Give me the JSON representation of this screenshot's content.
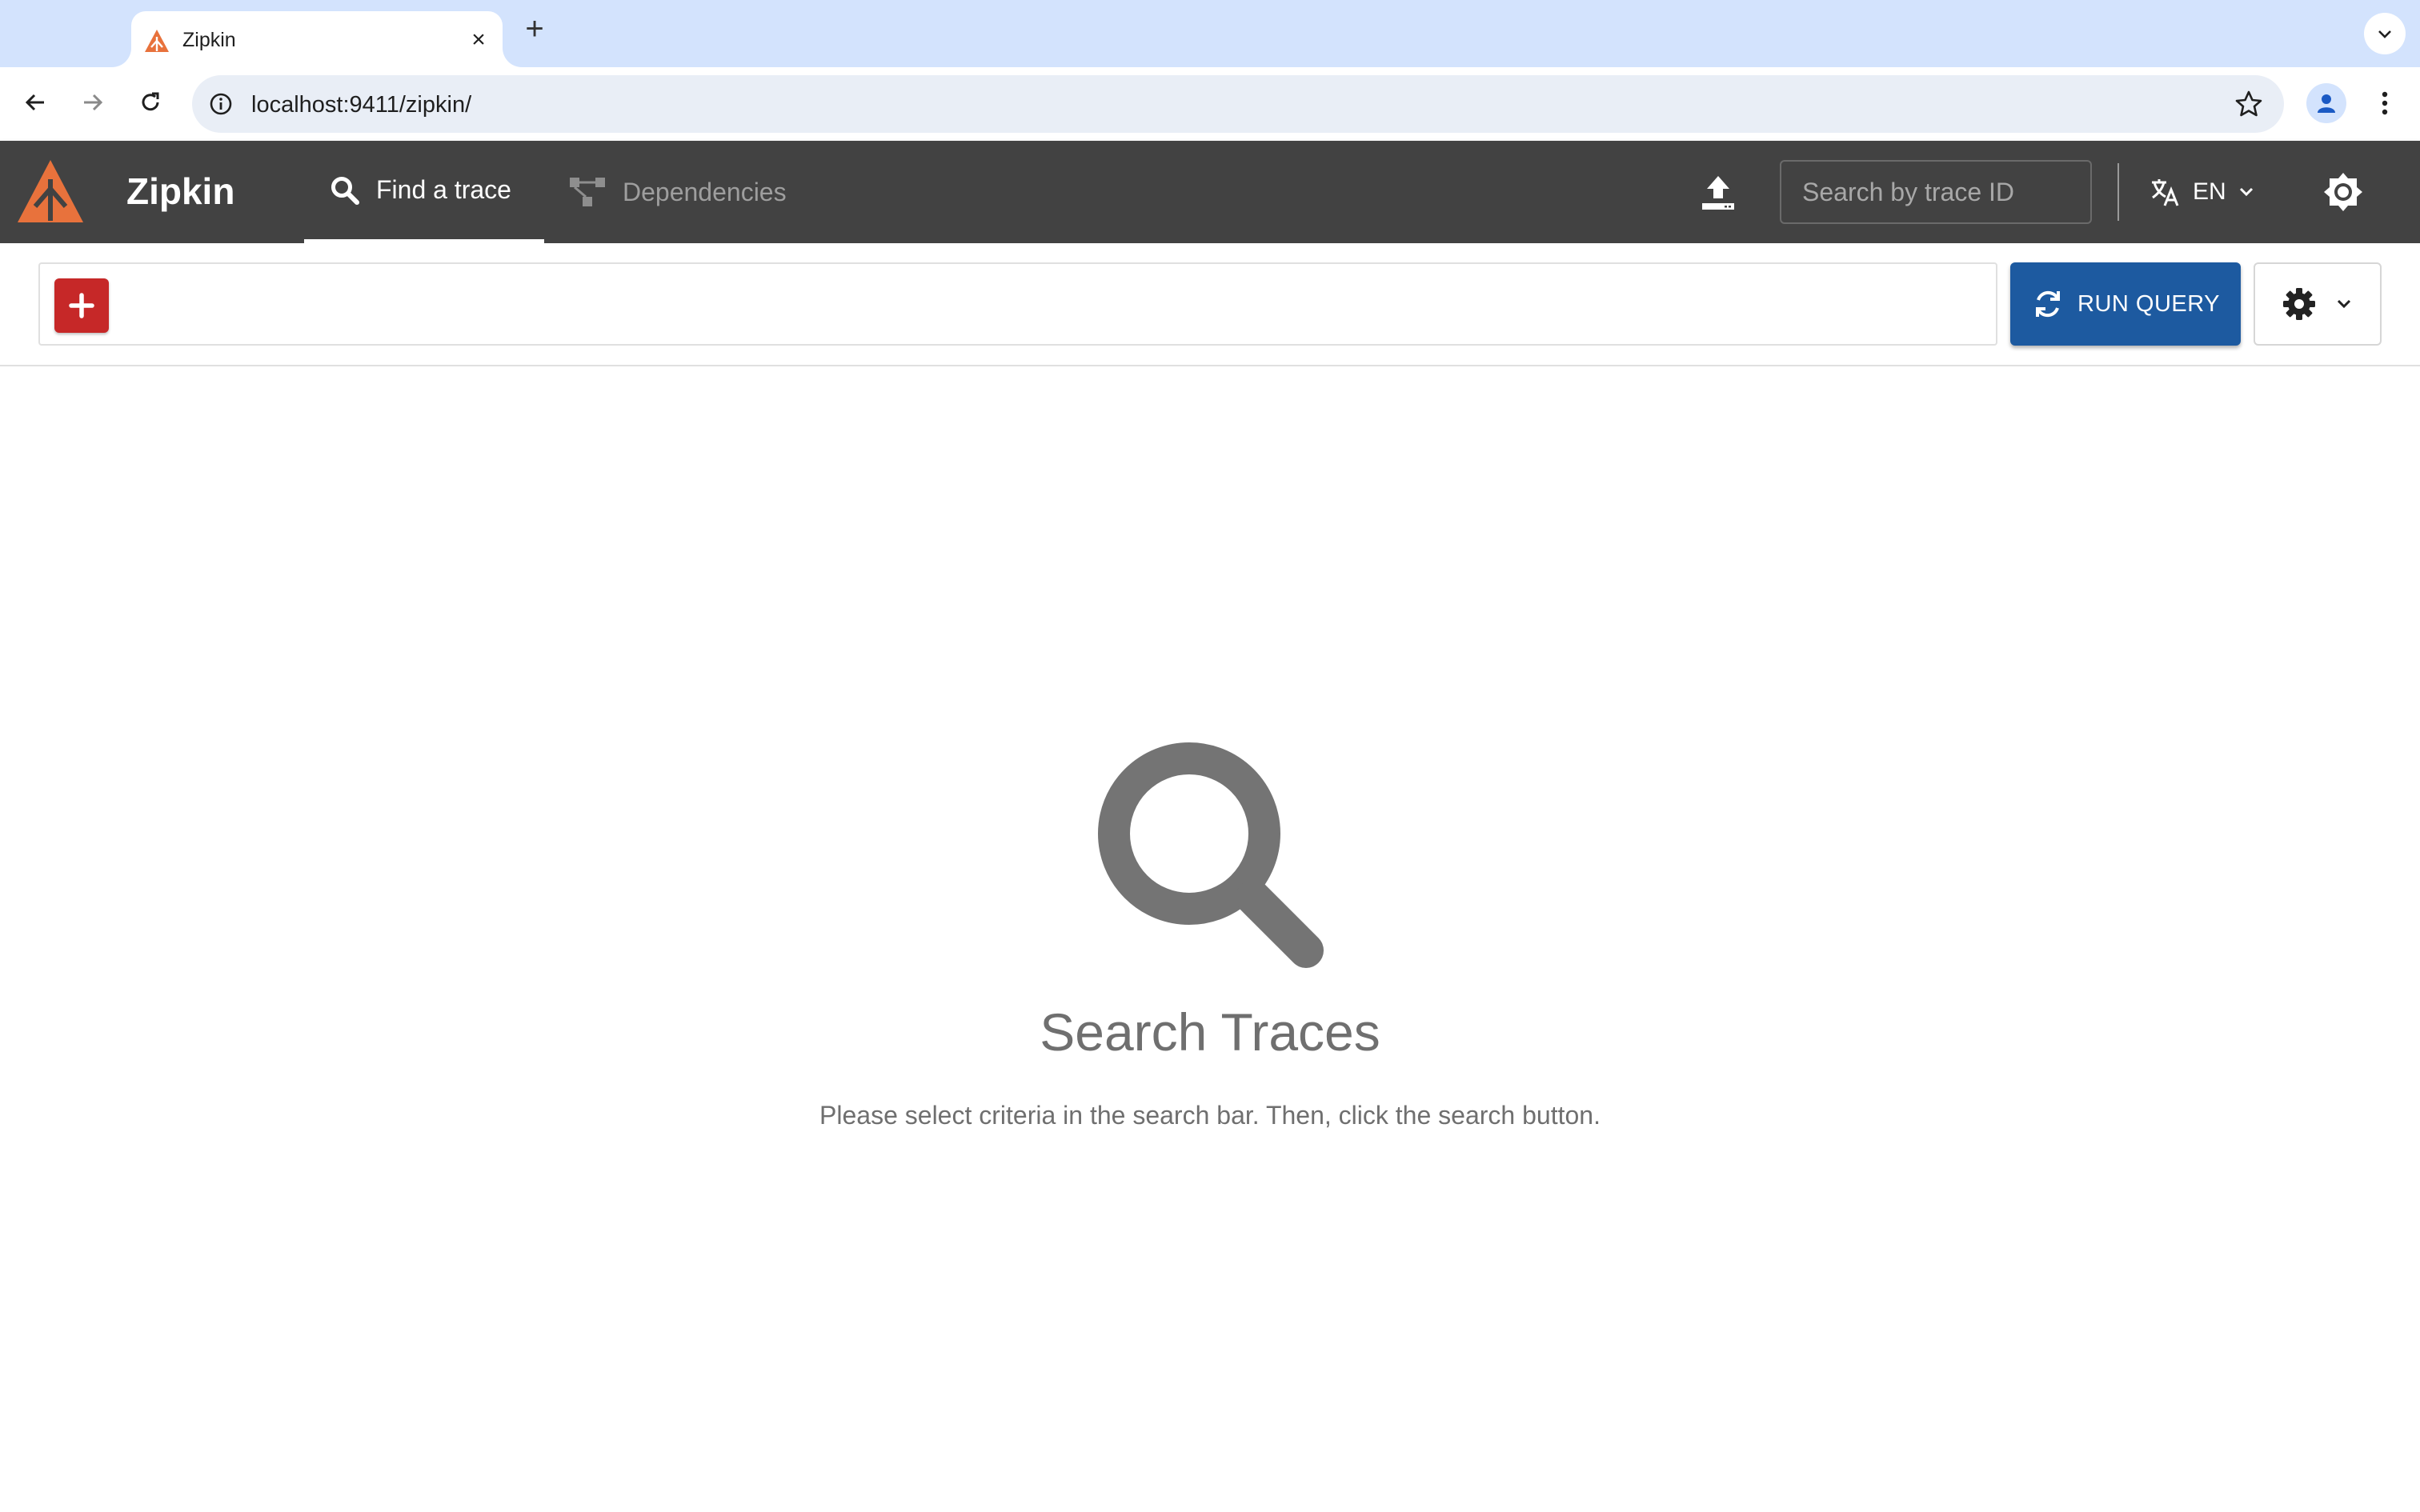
{
  "browser": {
    "tab_title": "Zipkin",
    "tab_close": "×",
    "new_tab": "+",
    "url": "localhost:9411/zipkin/"
  },
  "header": {
    "app_title": "Zipkin",
    "nav": {
      "find_label": "Find a trace",
      "deps_label": "Dependencies"
    },
    "trace_search_placeholder": "Search by trace ID",
    "language": "EN"
  },
  "search_bar": {
    "run_query_label": "RUN QUERY"
  },
  "empty_state": {
    "title": "Search Traces",
    "description": "Please select criteria in the search bar. Then, click the search button."
  },
  "colors": {
    "header_bg": "#424242",
    "logo_orange": "#e8723c",
    "add_button": "#c62828",
    "run_query_button": "#1d5aa0",
    "tabstrip_bg": "#d3e3fd",
    "empty_state_gray": "#6f6f6f"
  },
  "icons": {
    "tab": "zipkin-favicon",
    "omnibox": [
      "info-icon",
      "star-icon"
    ],
    "header": [
      "search-icon",
      "dependencies-icon",
      "upload-icon",
      "translate-icon",
      "chevron-down-icon",
      "theme-icon"
    ],
    "search_bar": [
      "plus-icon",
      "refresh-icon",
      "gear-icon",
      "chevron-down-icon"
    ],
    "empty_state": "search-icon"
  }
}
